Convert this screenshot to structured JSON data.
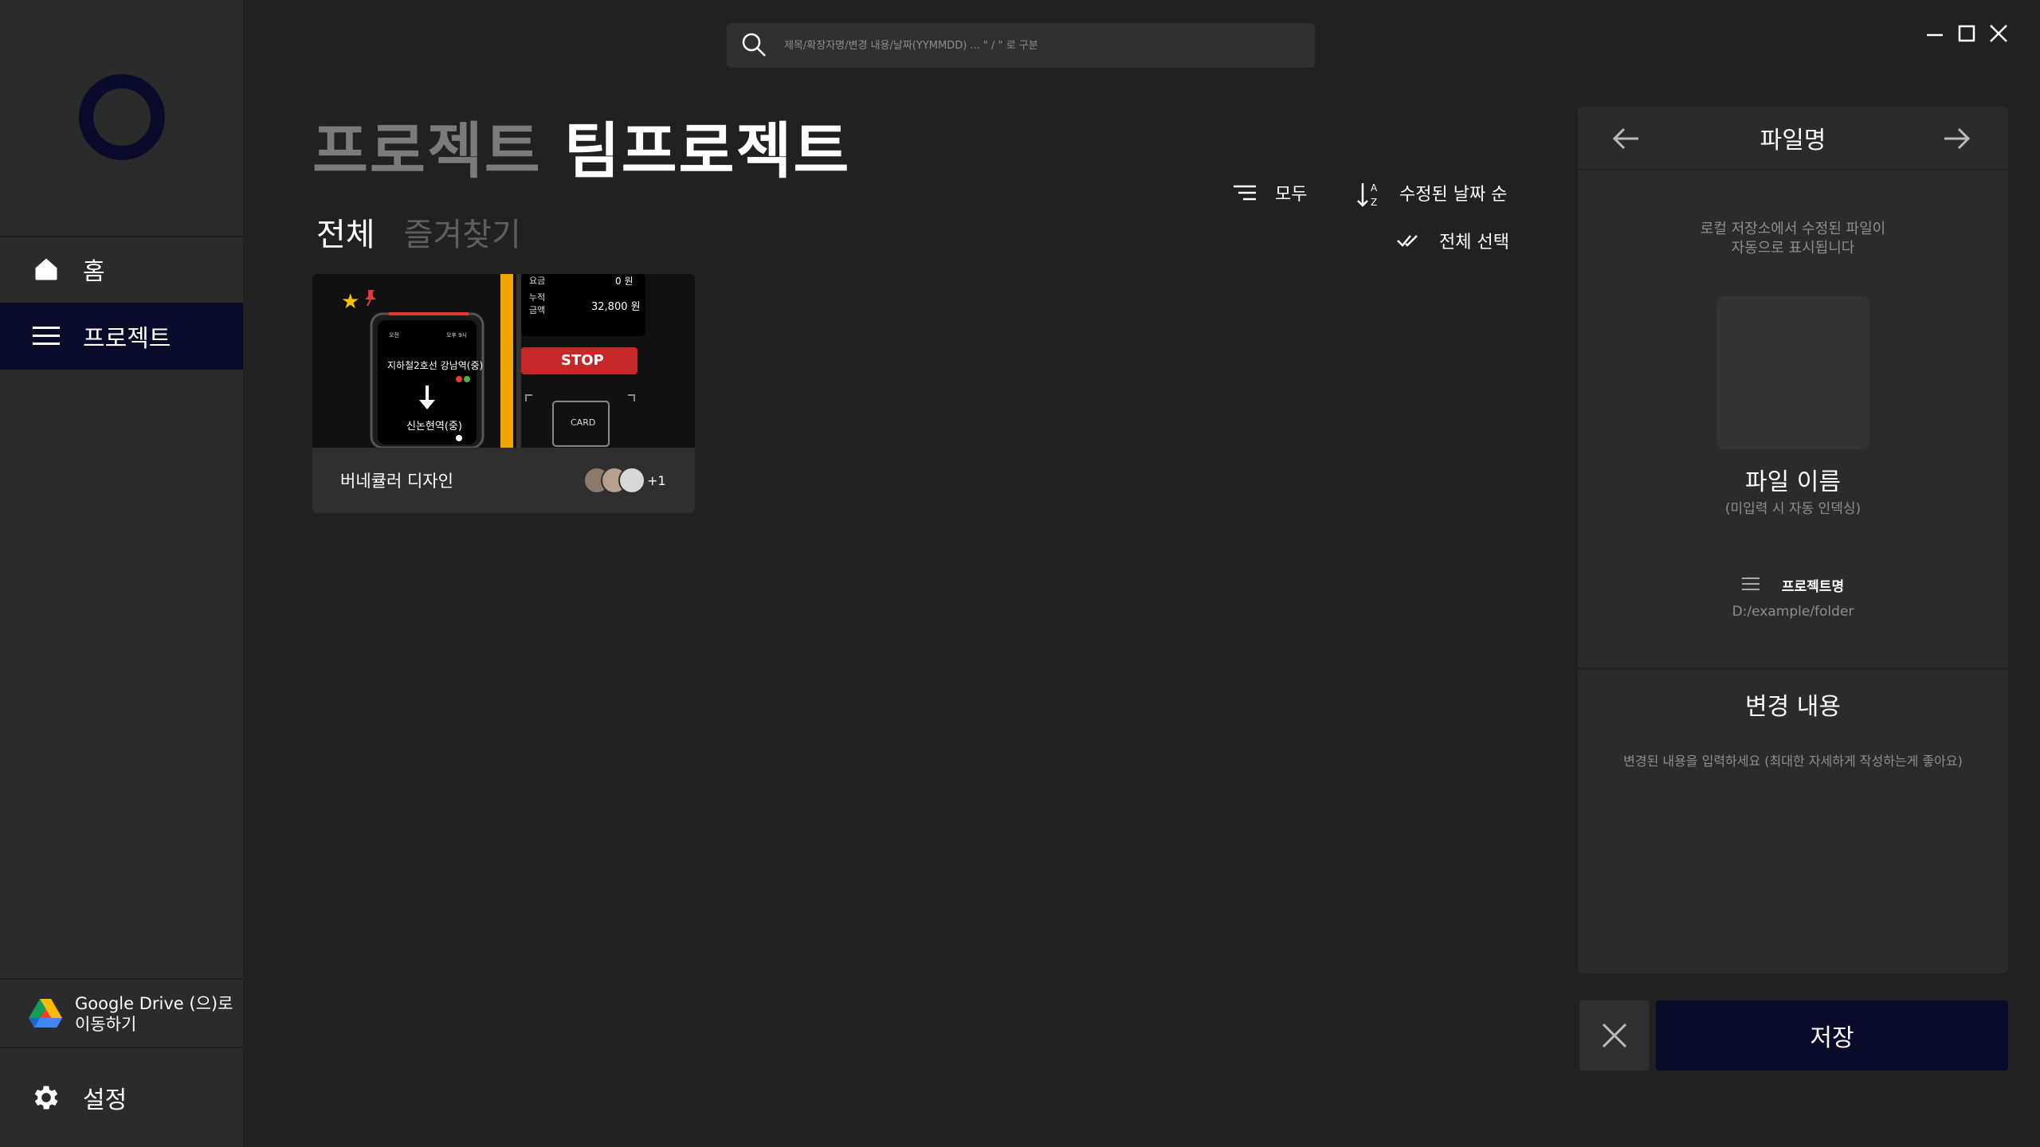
{
  "sidebar": {
    "logo_icon": "ring-logo-icon",
    "items": [
      {
        "label": "홈",
        "icon": "home-icon"
      },
      {
        "label": "프로젝트",
        "icon": "menu-icon",
        "active": true
      }
    ],
    "gdrive": {
      "label": "Google Drive (으)로 이동하기",
      "icon": "google-drive-icon"
    },
    "settings": {
      "label": "설정",
      "icon": "gear-icon"
    }
  },
  "search": {
    "placeholder": "제목/확장자명/변경 내용/날짜(YYMMDD) ... \" / \" 로 구분"
  },
  "window_controls": [
    "minimize-icon",
    "maximize-icon",
    "close-icon"
  ],
  "header": {
    "crumb": "프로젝트",
    "current": "팀프로젝트"
  },
  "tabs": [
    {
      "label": "전체",
      "active": true
    },
    {
      "label": "즐겨찾기",
      "active": false
    }
  ],
  "toolbar": {
    "filter_label": "모두",
    "sort_label": "수정된 날짜 순",
    "select_all_label": "전체 선택"
  },
  "cards": [
    {
      "name": "버네큘러 디자인",
      "members_more": "+1",
      "thumb": {
        "time_left": "오전",
        "time_right": "오후 9시",
        "line": "지하철2호선 강남역(중)",
        "next": "신논현역(중)",
        "fare_label": "요금",
        "fare_value": "0 원",
        "total_label": "누적\n금액",
        "total_value": "32,800 원",
        "stop": "STOP",
        "card": "CARD"
      }
    }
  ],
  "panel": {
    "title": "파일명",
    "hint": "로컬 저장소에서 수정된 파일이\n자동으로 표시됩니다",
    "filename": "파일 이름",
    "filename_sub": "(미입력 시 자동 인덱싱)",
    "project_name": "프로젝트명",
    "path": "D:/example/folder",
    "change_title": "변경 내용",
    "change_placeholder": "변경된 내용을 입력하세요 (최대한 자세하게 작성하는게 좋아요)"
  },
  "actions": {
    "save_label": "저장"
  },
  "colors": {
    "background": "#212121",
    "sidebar": "#2b2b2b",
    "accent": "#0a0b2a",
    "muted": "#7b7b7b"
  }
}
